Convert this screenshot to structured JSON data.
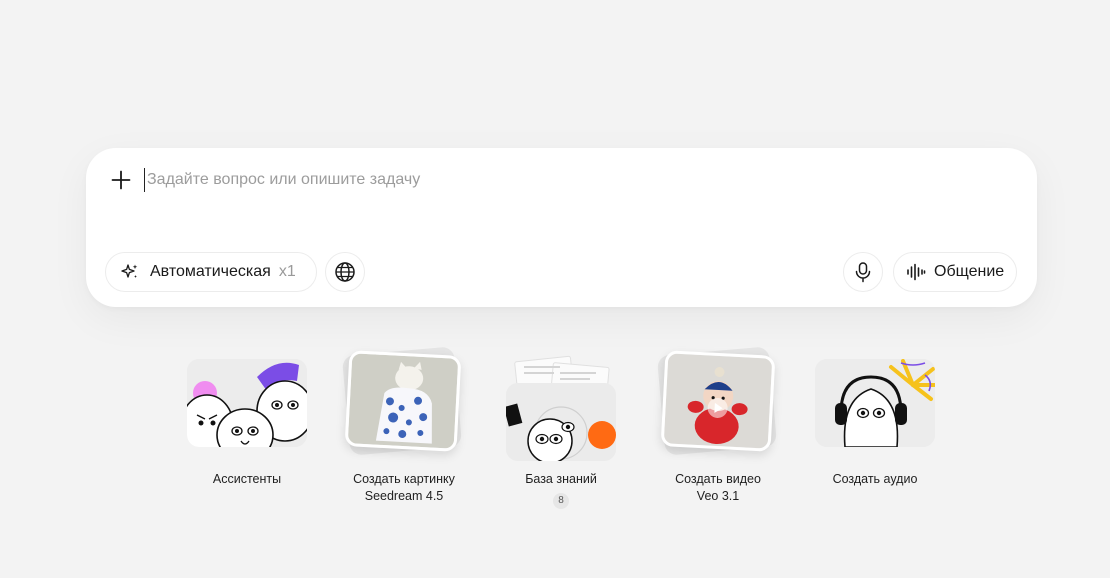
{
  "composer": {
    "placeholder": "Задайте вопрос или опишите задачу",
    "mode_label": "Автоматическая",
    "mode_multiplier": "x1",
    "talk_label": "Общение"
  },
  "icons": {
    "attach": "plus-icon",
    "mode": "sparkle-icon",
    "web": "globe-icon",
    "mic": "microphone-icon",
    "talk": "waveform-icon"
  },
  "cards": [
    {
      "title": "Ассистенты",
      "subtitle": ""
    },
    {
      "title": "Создать картинку",
      "subtitle": "Seedream 4.5"
    },
    {
      "title": "База знаний",
      "subtitle": "",
      "badge": "8"
    },
    {
      "title": "Создать видео",
      "subtitle": "Veo 3.1"
    },
    {
      "title": "Создать аудио",
      "subtitle": ""
    }
  ],
  "colors": {
    "background": "#f3f3f3",
    "surface": "#ffffff",
    "accent_purple": "#7b4de6",
    "accent_orange": "#ff6a13",
    "accent_pink": "#f08df0",
    "accent_yellow": "#f6c21c"
  }
}
